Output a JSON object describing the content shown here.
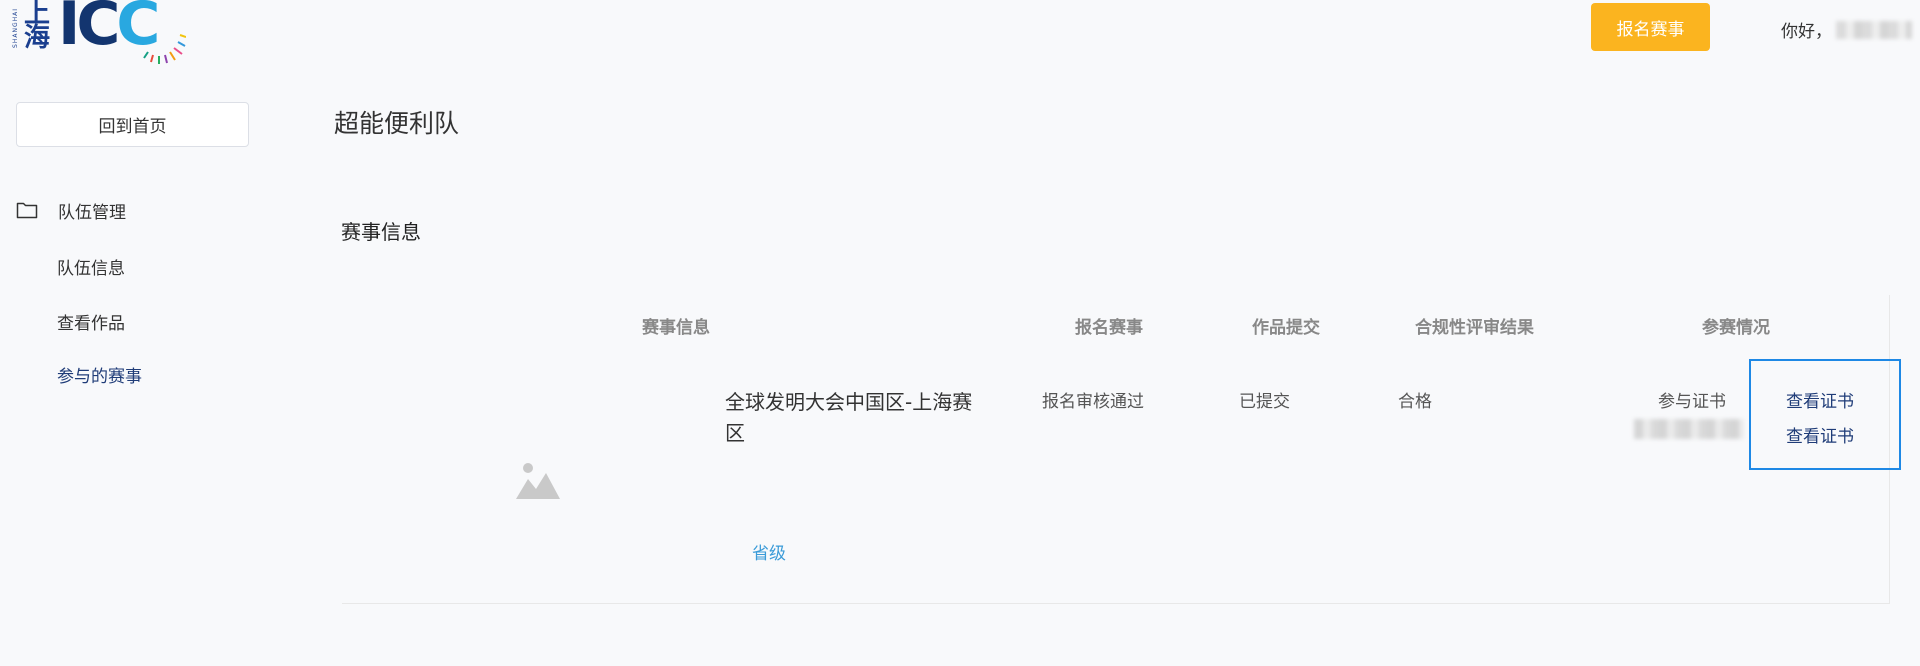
{
  "header": {
    "logo_text": "ICC",
    "logo_city": "上海",
    "logo_side_text": "SHANGHAI",
    "signup_button": "报名赛事",
    "greeting": "你好，"
  },
  "sidebar": {
    "home_button": "回到首页",
    "group_label": "队伍管理",
    "items": [
      {
        "label": "队伍信息"
      },
      {
        "label": "查看作品"
      },
      {
        "label": "参与的赛事"
      }
    ]
  },
  "main": {
    "team_name": "超能便利队",
    "section_title": "赛事信息",
    "table": {
      "headers": [
        "赛事信息",
        "报名赛事",
        "作品提交",
        "合规性评审结果",
        "参赛情况"
      ],
      "row": {
        "event_name": "全球发明大会中国区-上海赛区",
        "level": "省级",
        "signup_status": "报名审核通过",
        "submission_status": "已提交",
        "review_result": "合格",
        "participation": "参与证书",
        "cert_links": [
          "查看证书",
          "查看证书"
        ]
      }
    }
  },
  "colors": {
    "accent_orange": "#fbb41f",
    "link_blue": "#3a9bd8",
    "highlight_border": "#1e88e5",
    "nav_active": "#1f3c78"
  }
}
